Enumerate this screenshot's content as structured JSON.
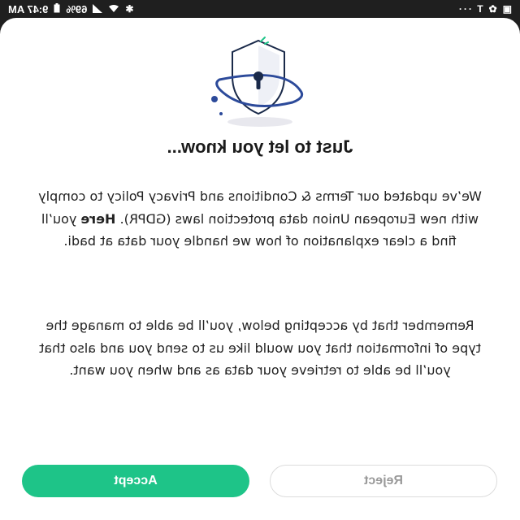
{
  "status_bar": {
    "time": "9:47 AM",
    "battery": "69%",
    "more": "···",
    "icons": [
      "bluetooth-icon",
      "wifi-icon",
      "signal-icon",
      "battery-icon",
      "fan-icon",
      "text-icon",
      "image-icon"
    ]
  },
  "dialog": {
    "title": "Just to let you know...",
    "paragraph1": {
      "before": "We’ve updated our Terms & Conditions and Privacy Policy to comply with new European Union data protection laws (GDPR). ",
      "bold": "Here",
      "after": " you’ll find a clear explanation of how we handle your data at badi."
    },
    "paragraph2": "Remember that by accepting below, you’ll be able to manage the type of information that you would like us to send you and also that you’ll be able to retrieve your data as and when you want.",
    "reject_label": "Reject",
    "accept_label": "Accept"
  },
  "colors": {
    "accent": "#1ec488",
    "illustration_blue": "#2c4a9a",
    "illustration_dark": "#1a2a4a"
  }
}
